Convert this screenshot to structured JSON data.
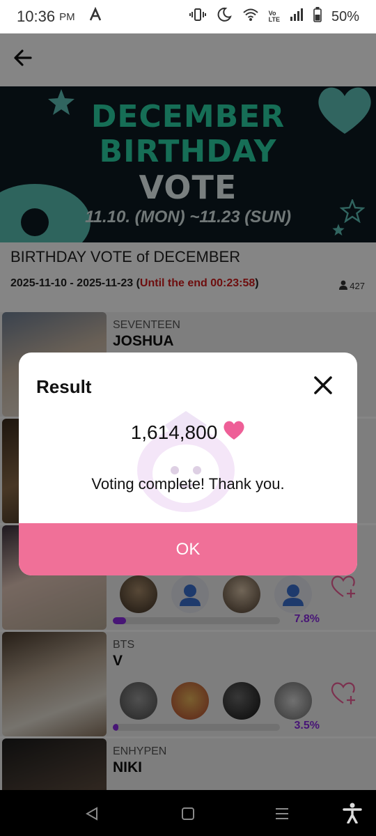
{
  "status_bar": {
    "time": "10:36",
    "ampm": "PM",
    "battery": "50%",
    "icons": [
      "app-a-icon",
      "vibrate-icon",
      "moon-icon",
      "wifi-icon",
      "volte-icon",
      "signal-icon",
      "battery-icon"
    ]
  },
  "banner": {
    "line1": "DECEMBER",
    "line2": "BIRTHDAY",
    "line3": "VOTE",
    "dates": "11.10. (MON) ~11.23 (SUN)"
  },
  "vote": {
    "title": "BIRTHDAY VOTE of DECEMBER",
    "date_range": "2025-11-10 - 2025-11-23 (",
    "until": "Until the end 00:23:58",
    "date_close": ")",
    "participants": "427"
  },
  "candidates": [
    {
      "group": "SEVENTEEN",
      "name": "JOSHUA",
      "percent": "",
      "share": null
    },
    {
      "group": "",
      "name": "",
      "percent": "",
      "share": null
    },
    {
      "group": "",
      "name": "",
      "percent": "7.8%",
      "share": 0.078
    },
    {
      "group": "BTS",
      "name": "V",
      "percent": "3.5%",
      "share": 0.035
    },
    {
      "group": "ENHYPEN",
      "name": "NIKI",
      "percent": "",
      "share": null
    }
  ],
  "modal": {
    "title": "Result",
    "amount": "1,614,800",
    "message": "Voting complete! Thank you.",
    "ok_label": "OK"
  },
  "colors": {
    "accent_pink": "#f07098",
    "heart_pink": "#ee5f97",
    "progress_purple": "#8a2be2",
    "countdown_red": "#d21b1b"
  }
}
